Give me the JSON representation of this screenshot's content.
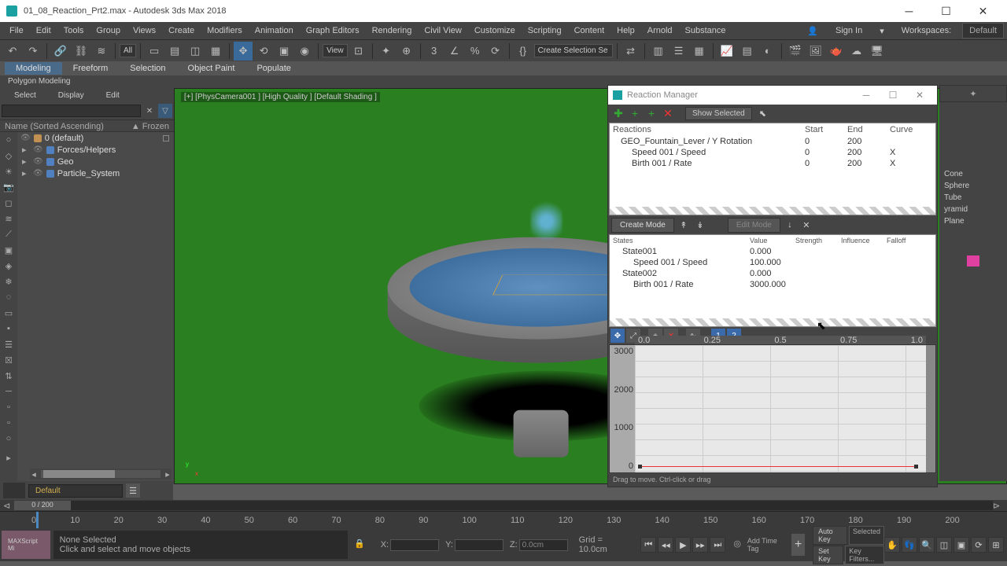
{
  "title": "01_08_Reaction_Prt2.max - Autodesk 3ds Max 2018",
  "menus": [
    "File",
    "Edit",
    "Tools",
    "Group",
    "Views",
    "Create",
    "Modifiers",
    "Animation",
    "Graph Editors",
    "Rendering",
    "Civil View",
    "Customize",
    "Scripting",
    "Content",
    "Help",
    "Arnold",
    "Substance"
  ],
  "sign_in": "Sign In",
  "workspaces_label": "Workspaces:",
  "workspaces_value": "Default",
  "toolbar_all": "All",
  "toolbar_view": "View",
  "toolbar_createsel": "Create Selection Se",
  "ribbon_tabs": [
    "Modeling",
    "Freeform",
    "Selection",
    "Object Paint",
    "Populate"
  ],
  "poly_modeling": "Polygon Modeling",
  "scene_explorer": {
    "tabs": [
      "Select",
      "Display",
      "Edit"
    ],
    "header_name": "Name (Sorted Ascending)",
    "header_frozen": "▲ Frozen",
    "items": [
      "0 (default)",
      "Forces/Helpers",
      "Geo",
      "Particle_System"
    ]
  },
  "viewport_label": "[+] [PhysCamera001 ] [High Quality ] [Default Shading ]",
  "reaction_mgr": {
    "title": "Reaction Manager",
    "show_selected": "Show Selected",
    "rheaders": [
      "Reactions",
      "Start",
      "End",
      "Curve"
    ],
    "rows": [
      {
        "n": "GEO_Fountain_Lever / Y Rotation",
        "s": "0",
        "e": "200",
        "c": ""
      },
      {
        "n": "Speed 001 / Speed",
        "s": "0",
        "e": "200",
        "c": "X"
      },
      {
        "n": "Birth 001 / Rate",
        "s": "0",
        "e": "200",
        "c": "X"
      }
    ],
    "create_mode": "Create Mode",
    "edit_mode": "Edit Mode",
    "sheaders": [
      "States",
      "Value",
      "Strength",
      "Influence",
      "Falloff"
    ],
    "states": [
      {
        "n": "State001",
        "v": "0.000"
      },
      {
        "n": "Speed 001 / Speed",
        "v": "100.000"
      },
      {
        "n": "State002",
        "v": "0.000"
      },
      {
        "n": "Birth 001 / Rate",
        "v": "3000.000"
      }
    ],
    "curve_btns": [
      "1",
      "2"
    ],
    "curve_x": [
      "0.0",
      "0.25",
      "0.5",
      "0.75",
      "1.0"
    ],
    "curve_y": [
      "3000",
      "2000",
      "1000",
      "0"
    ],
    "status": "Drag to move. Ctrl-click or drag"
  },
  "cmd_objs": [
    "Cone",
    "Sphere",
    "Tube",
    "yramid",
    "Plane"
  ],
  "material_default": "Default",
  "timeline_frames": [
    "0",
    "10",
    "20",
    "30",
    "40",
    "50",
    "60",
    "70",
    "80",
    "90",
    "100",
    "110",
    "120",
    "130",
    "140",
    "150",
    "160",
    "170",
    "180",
    "190",
    "200"
  ],
  "timeline_range": "0 / 200",
  "status": {
    "none_selected": "None Selected",
    "hint": "Click and select and move objects",
    "maxscript": "MAXScript Mi",
    "x": "X:",
    "y": "Y:",
    "z": "Z:",
    "xval": "",
    "yval": "",
    "zval": "0.0cm",
    "grid": "Grid = 10.0cm",
    "add_time_tag": "Add Time Tag",
    "auto_key": "Auto Key",
    "set_key": "Set Key",
    "selected": "Selected",
    "key_filters": "Key Filters..."
  }
}
